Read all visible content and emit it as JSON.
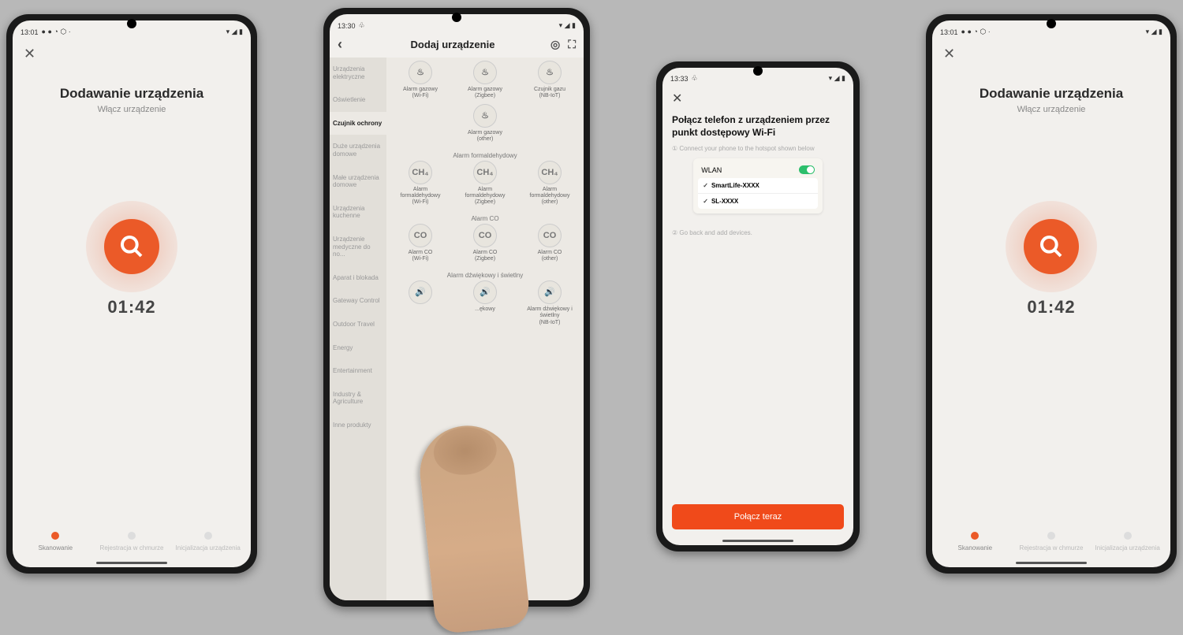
{
  "statusbar": {
    "time_1": "13:01",
    "time_2": "13:30",
    "time_3": "13:33",
    "time_4": "13:01",
    "icons": "● ● ◔ ⬡ ·",
    "right": "▾ ◢ ▮"
  },
  "screen1": {
    "title": "Dodawanie urządzenia",
    "subtitle": "Włącz urządzenie",
    "timer": "01:42",
    "steps": [
      "Skanowanie",
      "Rejestracja w chmurze",
      "Inicjalizacja urządzenia"
    ]
  },
  "screen2": {
    "title": "Dodaj urządzenie",
    "sidebar": [
      "Urządzenia elektryczne",
      "Oświetlenie",
      "Czujnik ochrony",
      "Duże urządzenia domowe",
      "Małe urządzenia domowe",
      "Urządzenia kuchenne",
      "Urządzenie medyczne do no...",
      "Aparat i blokada",
      "Gateway Control",
      "Outdoor Travel",
      "Energy",
      "Entertainment",
      "Industry & Agriculture",
      "Inne produkty"
    ],
    "sidebar_active_index": 2,
    "sections": [
      {
        "label": "",
        "items": [
          {
            "icon": "♨",
            "name": "Alarm gazowy",
            "sub": "(Wi-Fi)"
          },
          {
            "icon": "♨",
            "name": "Alarm gazowy",
            "sub": "(Zigbee)"
          },
          {
            "icon": "♨",
            "name": "Czujnik gazu",
            "sub": "(NB-IoT)"
          }
        ]
      },
      {
        "label": "",
        "items": [
          {
            "icon": "♨",
            "name": "Alarm gazowy",
            "sub": "(other)"
          }
        ]
      },
      {
        "label": "Alarm formaldehydowy",
        "items": [
          {
            "icon": "CH₄",
            "name": "Alarm formaldehydowy",
            "sub": "(Wi-Fi)"
          },
          {
            "icon": "CH₄",
            "name": "Alarm formaldehydowy",
            "sub": "(Zigbee)"
          },
          {
            "icon": "CH₄",
            "name": "Alarm formaldehydowy",
            "sub": "(other)"
          }
        ]
      },
      {
        "label": "Alarm CO",
        "items": [
          {
            "icon": "CO",
            "name": "Alarm CO",
            "sub": "(Wi-Fi)"
          },
          {
            "icon": "CO",
            "name": "Alarm CO",
            "sub": "(Zigbee)"
          },
          {
            "icon": "CO",
            "name": "Alarm CO",
            "sub": "(other)"
          }
        ]
      },
      {
        "label": "Alarm dźwiękowy i świetlny",
        "items": [
          {
            "icon": "🔊",
            "name": "",
            "sub": ""
          },
          {
            "icon": "🔊",
            "name": "...ękowy",
            "sub": ""
          },
          {
            "icon": "🔊",
            "name": "Alarm dźwiękowy i świetlny",
            "sub": "(NB-IoT)"
          }
        ]
      }
    ]
  },
  "screen3": {
    "title": "Połącz telefon z urządzeniem przez punkt dostępowy Wi-Fi",
    "step1": "① Connect your phone to the hotspot shown below",
    "wlan": "WLAN",
    "ssids": [
      "SmartLife-XXXX",
      "SL-XXXX"
    ],
    "step2": "② Go back and add devices.",
    "button": "Połącz teraz"
  }
}
